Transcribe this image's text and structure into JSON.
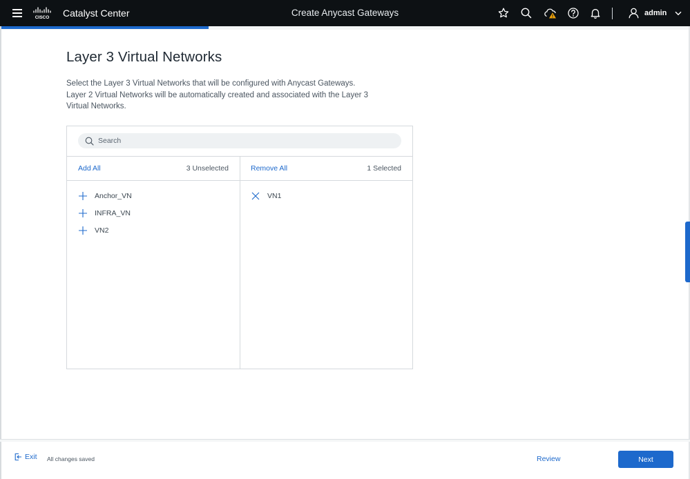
{
  "header": {
    "app_title": "Catalyst Center",
    "page_title": "Create Anycast Gateways",
    "user_name": "admin",
    "icons": [
      "menu-icon",
      "cisco-logo",
      "star-icon",
      "search-icon",
      "cloud-warning-icon",
      "help-icon",
      "bell-icon",
      "user-icon",
      "chevron-down-icon"
    ],
    "warning_color": "#f0a30a"
  },
  "progress": {
    "fraction": 0.3
  },
  "main": {
    "heading": "Layer 3 Virtual Networks",
    "description": "Select the Layer 3 Virtual Networks that will be configured with Anycast Gateways. Layer 2 Virtual Networks will be automatically created and associated with the Layer 3 Virtual Networks."
  },
  "transfer": {
    "search_placeholder": "Search",
    "left": {
      "action_label": "Add All",
      "count_label": "3 Unselected",
      "items": [
        "Anchor_VN",
        "INFRA_VN",
        "VN2"
      ]
    },
    "right": {
      "action_label": "Remove All",
      "count_label": "1 Selected",
      "items": [
        "VN1"
      ]
    }
  },
  "footer": {
    "exit_label": "Exit",
    "status_text": "All changes saved",
    "review_label": "Review",
    "next_label": "Next"
  },
  "colors": {
    "accent": "#1d69cc",
    "topbar": "#0d1114"
  }
}
